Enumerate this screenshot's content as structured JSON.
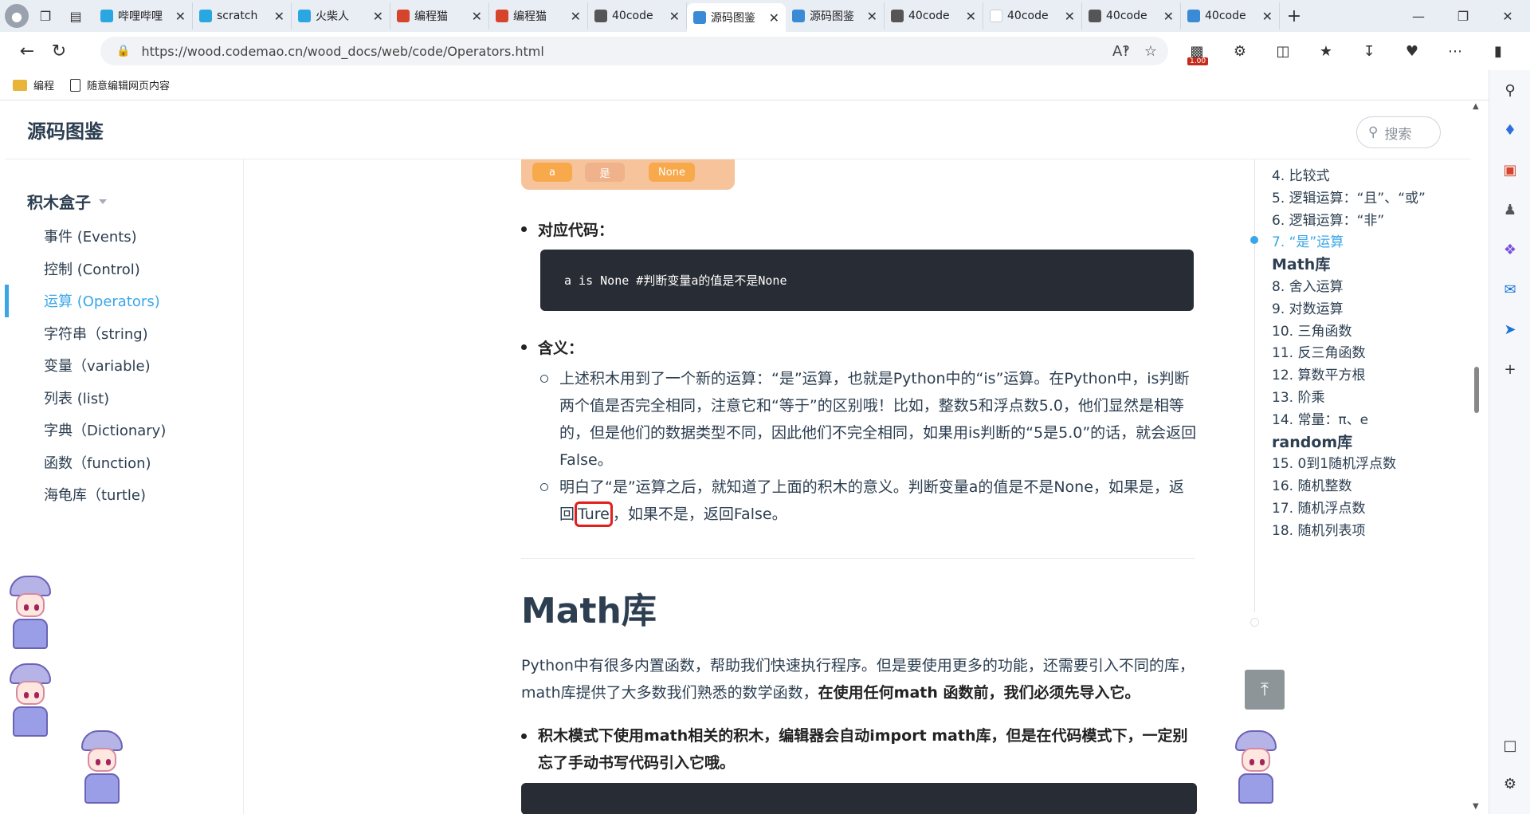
{
  "browser": {
    "tabs": [
      {
        "title": "哔哩哔哩",
        "color": "#2aa6e0",
        "active": false
      },
      {
        "title": "scratch",
        "color": "#2aa6e0",
        "active": false
      },
      {
        "title": "火柴人",
        "color": "#2aa6e0",
        "active": false
      },
      {
        "title": "编程猫",
        "color": "#d6452b",
        "active": false
      },
      {
        "title": "编程猫",
        "color": "#d6452b",
        "active": false
      },
      {
        "title": "40code",
        "color": "#555555",
        "active": false
      },
      {
        "title": "源码图鉴",
        "color": "#3a8ad6",
        "active": true
      },
      {
        "title": "源码图鉴",
        "color": "#3a8ad6",
        "active": false
      },
      {
        "title": "40code",
        "color": "#555555",
        "active": false
      },
      {
        "title": "40code",
        "color": "#ffffff",
        "active": false
      },
      {
        "title": "40code",
        "color": "#555555",
        "active": false
      },
      {
        "title": "40code",
        "color": "#3a8ad6",
        "active": false
      }
    ],
    "url": "https://wood.codemao.cn/wood_docs/web/code/Operators.html",
    "zoom_badge": "1.00",
    "bookmarks": [
      "编程",
      "随意编辑网页内容"
    ]
  },
  "site": {
    "brand": "源码图鉴",
    "search_placeholder": "搜索"
  },
  "leftnav": {
    "group": "积木盒子",
    "items": [
      {
        "label": "事件 (Events)",
        "active": false
      },
      {
        "label": "控制 (Control)",
        "active": false
      },
      {
        "label": "运算 (Operators)",
        "active": true
      },
      {
        "label": "字符串（string)",
        "active": false
      },
      {
        "label": "变量（variable)",
        "active": false
      },
      {
        "label": "列表 (list)",
        "active": false
      },
      {
        "label": "字典（Dictionary)",
        "active": false
      },
      {
        "label": "函数（function)",
        "active": false
      },
      {
        "label": "海龟库（turtle)",
        "active": false
      }
    ]
  },
  "block_image": {
    "a": "a",
    "is": "是",
    "none": "None"
  },
  "content": {
    "code_heading": "对应代码：",
    "code_line": "a is None #判断变量a的值是不是None",
    "meaning_heading": "含义：",
    "meaning_p1": "上述积木用到了一个新的运算：“是”运算，也就是Python中的“is”运算。在Python中，is判断两个值是否完全相同，注意它和“等于”的区别哦！比如，整数5和浮点数5.0，他们显然是相等的，但是他们的数据类型不同，因此他们不完全相同，如果用is判断的“5是5.0”的话，就会返回False。",
    "meaning_p2_before": "明白了“是”运算之后，就知道了上面的积木的意义。判断变量a的值是不是None，如果是，返回",
    "meaning_p2_highlight": "Ture",
    "meaning_p2_after": "，如果不是，返回False。",
    "math_title": "Math库",
    "math_intro_plain": "Python中有很多内置函数，帮助我们快速执行程序。但是要使用更多的功能，还需要引入不同的库，math库提供了大多数我们熟悉的数学函数，",
    "math_intro_bold": "在使用任何math 函数前，我们必须先导入它。",
    "math_bullet": "积木模式下使用math相关的积木，编辑器会自动import math库，但是在代码模式下，一定别忘了手动书写代码引入它哦。"
  },
  "toc": {
    "items": [
      {
        "label": "4. 比较式",
        "type": "item",
        "active": false
      },
      {
        "label": "5. 逻辑运算：“且”、“或”",
        "type": "item",
        "active": false
      },
      {
        "label": "6. 逻辑运算：“非”",
        "type": "item",
        "active": false
      },
      {
        "label": "7. “是”运算",
        "type": "item",
        "active": true
      },
      {
        "label": "Math库",
        "type": "heading",
        "active": false
      },
      {
        "label": "8. 舍入运算",
        "type": "item",
        "active": false
      },
      {
        "label": "9. 对数运算",
        "type": "item",
        "active": false
      },
      {
        "label": "10. 三角函数",
        "type": "item",
        "active": false
      },
      {
        "label": "11. 反三角函数",
        "type": "item",
        "active": false
      },
      {
        "label": "12. 算数平方根",
        "type": "item",
        "active": false
      },
      {
        "label": "13. 阶乘",
        "type": "item",
        "active": false
      },
      {
        "label": "14. 常量：π、e",
        "type": "item",
        "active": false
      },
      {
        "label": "random库",
        "type": "heading",
        "active": false
      },
      {
        "label": "15. 0到1随机浮点数",
        "type": "item",
        "active": false
      },
      {
        "label": "16. 随机整数",
        "type": "item",
        "active": false
      },
      {
        "label": "17. 随机浮点数",
        "type": "item",
        "active": false
      },
      {
        "label": "18. 随机列表项",
        "type": "item",
        "active": false
      }
    ]
  }
}
